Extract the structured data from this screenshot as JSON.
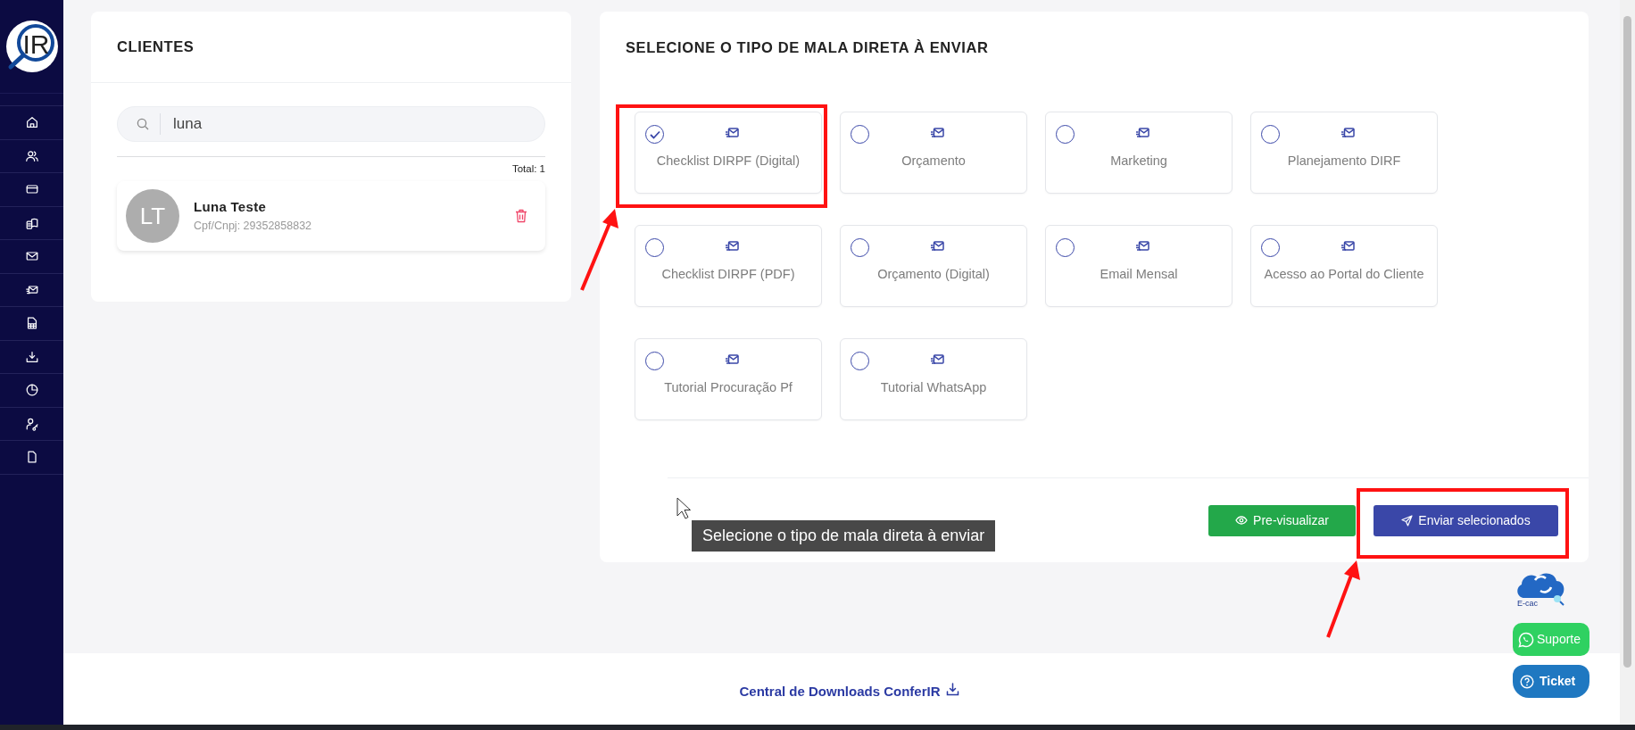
{
  "logo": {
    "text": "IR"
  },
  "clients_panel": {
    "title": "CLIENTES",
    "search": {
      "value": "luna"
    },
    "total": "Total: 1",
    "clients": [
      {
        "initials": "LT",
        "name": "Luna Teste",
        "document": "Cpf/Cnpj: 29352858832"
      }
    ]
  },
  "mail_panel": {
    "title": "SELECIONE O TIPO DE MALA DIRETA À ENVIAR",
    "options": [
      {
        "label": "Checklist DIRPF (Digital)",
        "selected": true
      },
      {
        "label": "Orçamento",
        "selected": false
      },
      {
        "label": "Marketing",
        "selected": false
      },
      {
        "label": "Planejamento DIRF",
        "selected": false
      },
      {
        "label": "Checklist DIRPF (PDF)",
        "selected": false
      },
      {
        "label": "Orçamento (Digital)",
        "selected": false
      },
      {
        "label": "Email Mensal",
        "selected": false
      },
      {
        "label": "Acesso ao Portal do Cliente",
        "selected": false
      },
      {
        "label": "Tutorial Procuração Pf",
        "selected": false
      },
      {
        "label": "Tutorial WhatsApp",
        "selected": false
      }
    ],
    "buttons": [
      {
        "kind": "preview",
        "label": "Pre-visualizar"
      },
      {
        "kind": "send",
        "label": "Enviar selecionados"
      }
    ]
  },
  "tooltip": "Selecione o tipo de mala direta à enviar",
  "floating": {
    "ecac_label": "E-cac",
    "support": "Suporte",
    "ticket": "Ticket"
  },
  "footer": {
    "link": "Central de Downloads ConferIR"
  }
}
